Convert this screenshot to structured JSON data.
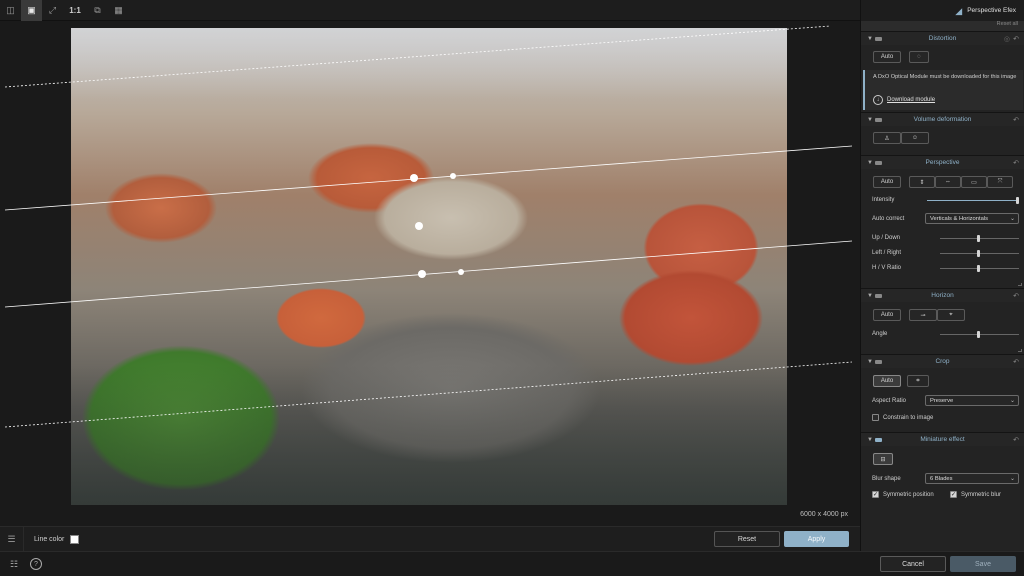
{
  "toolbar": {
    "tools": [
      {
        "icon": "compare-icon"
      },
      {
        "icon": "image-view-icon"
      },
      {
        "icon": "fit-screen-icon"
      },
      {
        "label": "1:1"
      },
      {
        "icon": "split-view-icon"
      },
      {
        "icon": "grid-icon"
      }
    ]
  },
  "canvas": {
    "dimensions": "6000 x 4000 px"
  },
  "linebar": {
    "line_color_label": "Line color",
    "line_color": "#ffffff",
    "reset_label": "Reset",
    "apply_label": "Apply"
  },
  "footer": {
    "cancel_label": "Cancel",
    "save_label": "Save"
  },
  "panel": {
    "app_title": "Perspective Efex",
    "reset_all": "Reset all",
    "distortion": {
      "title": "Distortion",
      "auto_label": "Auto",
      "notice": "A DxO Optical Module must be downloaded for this image",
      "download_label": "Download module"
    },
    "volume": {
      "title": "Volume deformation"
    },
    "perspective": {
      "title": "Perspective",
      "auto_label": "Auto",
      "intensity_label": "Intensity",
      "intensity_value": 1.0,
      "autocorrect_label": "Auto correct",
      "autocorrect_value": "Verticals & Horizontals",
      "updown_label": "Up / Down",
      "leftright_label": "Left / Right",
      "hv_label": "H / V Ratio"
    },
    "horizon": {
      "title": "Horizon",
      "auto_label": "Auto",
      "angle_label": "Angle"
    },
    "crop": {
      "title": "Crop",
      "auto_label": "Auto",
      "aspect_label": "Aspect Ratio",
      "aspect_value": "Preserve",
      "constrain_label": "Constrain to image",
      "constrain_checked": false
    },
    "miniature": {
      "title": "Miniature effect",
      "blur_shape_label": "Blur shape",
      "blur_shape_value": "6 Blades",
      "sym_position_label": "Symmetric position",
      "sym_position_checked": true,
      "sym_blur_label": "Symmetric blur",
      "sym_blur_checked": true
    }
  },
  "colors": {
    "accent": "#8fb1c8",
    "panel_bg": "#232323",
    "canvas_bg": "#1a1a1a"
  }
}
